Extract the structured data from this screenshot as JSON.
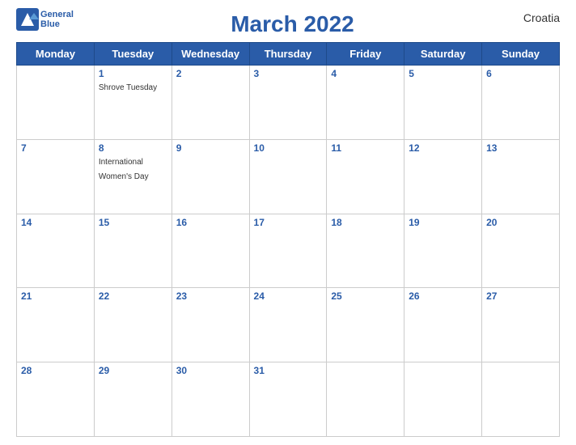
{
  "header": {
    "title": "March 2022",
    "country": "Croatia",
    "logo": {
      "line1": "General",
      "line2": "Blue"
    }
  },
  "weekdays": [
    "Monday",
    "Tuesday",
    "Wednesday",
    "Thursday",
    "Friday",
    "Saturday",
    "Sunday"
  ],
  "weeks": [
    [
      {
        "day": "",
        "empty": true
      },
      {
        "day": "1",
        "event": "Shrove Tuesday"
      },
      {
        "day": "2",
        "event": ""
      },
      {
        "day": "3",
        "event": ""
      },
      {
        "day": "4",
        "event": ""
      },
      {
        "day": "5",
        "event": ""
      },
      {
        "day": "6",
        "event": ""
      }
    ],
    [
      {
        "day": "7",
        "event": ""
      },
      {
        "day": "8",
        "event": "International Women's Day"
      },
      {
        "day": "9",
        "event": ""
      },
      {
        "day": "10",
        "event": ""
      },
      {
        "day": "11",
        "event": ""
      },
      {
        "day": "12",
        "event": ""
      },
      {
        "day": "13",
        "event": ""
      }
    ],
    [
      {
        "day": "14",
        "event": ""
      },
      {
        "day": "15",
        "event": ""
      },
      {
        "day": "16",
        "event": ""
      },
      {
        "day": "17",
        "event": ""
      },
      {
        "day": "18",
        "event": ""
      },
      {
        "day": "19",
        "event": ""
      },
      {
        "day": "20",
        "event": ""
      }
    ],
    [
      {
        "day": "21",
        "event": ""
      },
      {
        "day": "22",
        "event": ""
      },
      {
        "day": "23",
        "event": ""
      },
      {
        "day": "24",
        "event": ""
      },
      {
        "day": "25",
        "event": ""
      },
      {
        "day": "26",
        "event": ""
      },
      {
        "day": "27",
        "event": ""
      }
    ],
    [
      {
        "day": "28",
        "event": ""
      },
      {
        "day": "29",
        "event": ""
      },
      {
        "day": "30",
        "event": ""
      },
      {
        "day": "31",
        "event": ""
      },
      {
        "day": "",
        "empty": true
      },
      {
        "day": "",
        "empty": true
      },
      {
        "day": "",
        "empty": true
      }
    ]
  ]
}
